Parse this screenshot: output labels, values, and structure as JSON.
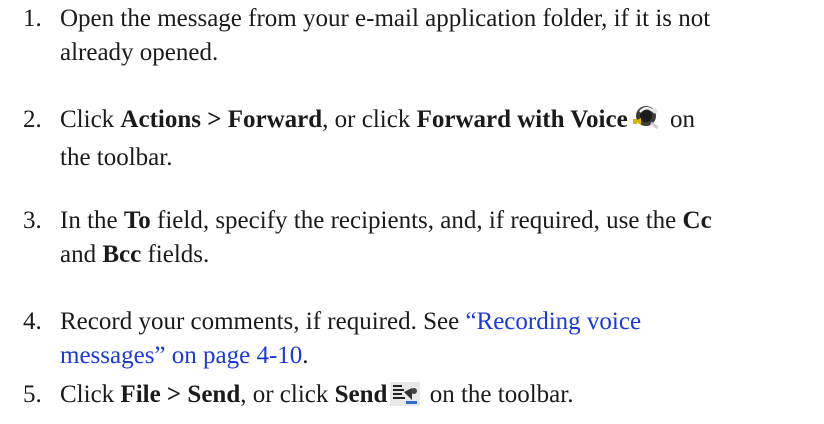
{
  "steps": [
    {
      "number": "1.",
      "line1": "Open the message from your e-mail application folder, if it is not",
      "line2": "already opened."
    },
    {
      "number": "2.",
      "click": "Click ",
      "actions_forward": "Actions > Forward",
      "or_click": ", or click ",
      "forward_with_voice": "Forward with Voice",
      "on": " on",
      "line2": "the toolbar.",
      "icon": "forward-with-voice-icon"
    },
    {
      "number": "3.",
      "in_the": "In the ",
      "to": "To",
      "specify": " field, specify the recipients, and, if required, use the ",
      "cc": "Cc",
      "and": "and ",
      "bcc": "Bcc",
      "fields": " fields."
    },
    {
      "number": "4.",
      "record": "Record your comments, if required. See ",
      "link_line1": "“Recording voice",
      "link_line2": "messages” on page 4-10",
      "period": "."
    },
    {
      "number": "5.",
      "click": "Click ",
      "file_send": "File > Send",
      "or_click": ", or click ",
      "send": "Send",
      "on_toolbar": " on the toolbar.",
      "icon": "send-icon"
    }
  ],
  "colors": {
    "text": "#1a1a1a",
    "link": "#1c39d6"
  }
}
